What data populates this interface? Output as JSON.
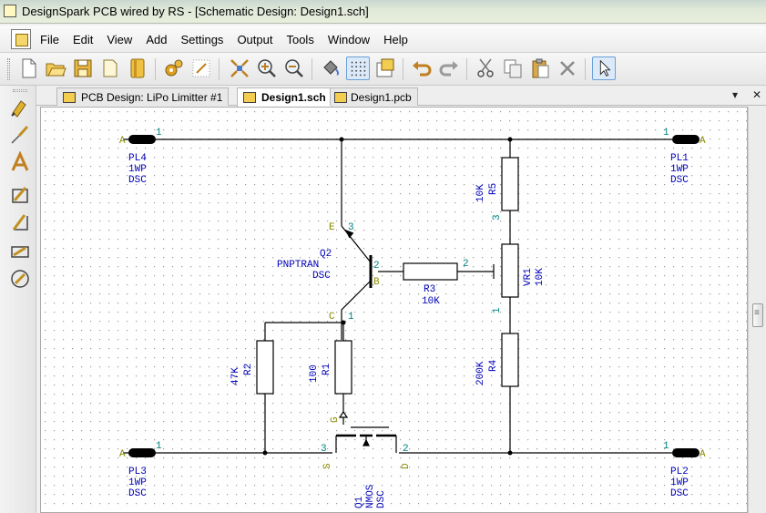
{
  "window": {
    "title": "DesignSpark PCB wired by RS - [Schematic Design: Design1.sch]",
    "controls": {
      "minimize": "–",
      "restore": "❐",
      "close": "✕"
    }
  },
  "menu": {
    "items": [
      "File",
      "Edit",
      "View",
      "Add",
      "Settings",
      "Output",
      "Tools",
      "Window",
      "Help"
    ]
  },
  "toolbar": {
    "buttons": [
      "new-file-icon",
      "open-folder-icon",
      "save-icon",
      "close-doc-icon",
      "library-icon",
      "design-tech-icon",
      "grid-settings-icon",
      "zoom-fit-icon",
      "zoom-in-icon",
      "zoom-out-icon",
      "fill-icon",
      "grid-toggle-icon",
      "properties-icon",
      "undo-icon",
      "redo-icon",
      "cut-icon",
      "copy-icon",
      "paste-icon",
      "delete-icon",
      "select-pointer-icon"
    ]
  },
  "tabs": {
    "items": [
      {
        "label": "PCB Design: LiPo Limitter #1",
        "active": false
      },
      {
        "label": "Design1.sch",
        "active": true
      },
      {
        "label": "Design1.pcb",
        "active": false
      }
    ],
    "dropdown": "▾",
    "close": "✕"
  },
  "colors": {
    "wire": "#000000",
    "component_text": "#0000b8",
    "pin_number": "#008080",
    "pin_name": "#8a8a00",
    "grid_dot": "#9a9a9a"
  },
  "schematic": {
    "PL4": {
      "ref": "PL4",
      "value": "1WP",
      "pkg": "DSC",
      "pin_name": "A",
      "pin_num": "1"
    },
    "PL1": {
      "ref": "PL1",
      "value": "1WP",
      "pkg": "DSC",
      "pin_name": "A",
      "pin_num": "1"
    },
    "PL3": {
      "ref": "PL3",
      "value": "1WP",
      "pkg": "DSC",
      "pin_name": "A",
      "pin_num": "1"
    },
    "PL2": {
      "ref": "PL2",
      "value": "1WP",
      "pkg": "DSC",
      "pin_name": "A",
      "pin_num": "1"
    },
    "R5": {
      "ref": "R5",
      "value": "10K",
      "pin_num": "3"
    },
    "VR1": {
      "ref": "VR1",
      "value": "10K",
      "pin_wiper": "2",
      "pin_bottom": "1"
    },
    "R3": {
      "ref": "R3",
      "value": "10K"
    },
    "R4": {
      "ref": "R4",
      "value": "200K"
    },
    "R2": {
      "ref": "R2",
      "value": "47K"
    },
    "R1": {
      "ref": "R1",
      "value": "100"
    },
    "Q2": {
      "ref": "Q2",
      "value": "PNPTRAN",
      "pkg": "DSC",
      "pin_e": "E",
      "pin_e_num": "3",
      "pin_b": "B",
      "pin_b_num": "2",
      "pin_c": "C",
      "pin_c_num": "1"
    },
    "Q1": {
      "ref": "Q1",
      "value": "NMOS",
      "pkg": "DSC",
      "pin_g": "G",
      "pin_s": "S",
      "pin_s_num": "3",
      "pin_d": "D",
      "pin_d_num": "2"
    }
  }
}
